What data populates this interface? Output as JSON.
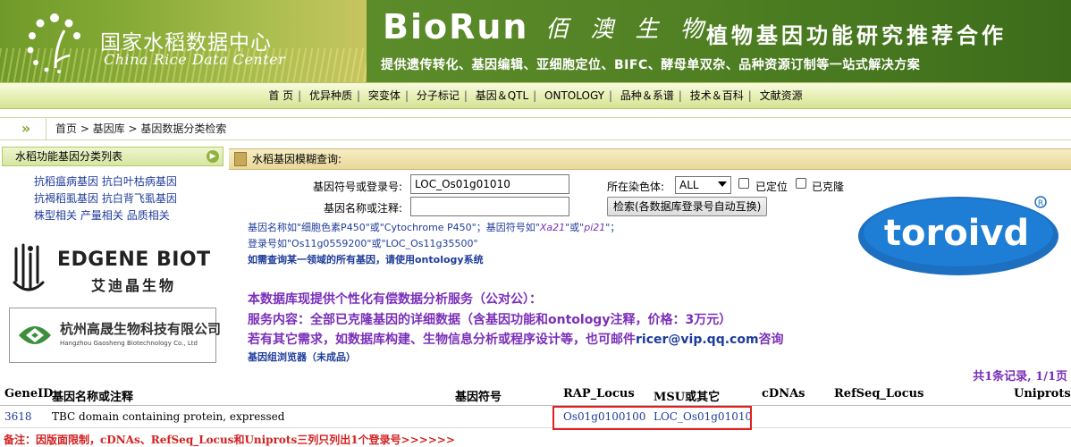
{
  "banner": {
    "cn_title": "国家水稻数据中心",
    "en_subtitle": "China Rice Data Center",
    "ad_brand": "BioRun",
    "ad_brand_cn": "佰 澳 生 物",
    "ad_slogan": "植物基因功能研究推荐合作",
    "ad_services": "提供遗传转化、基因编辑、亚细胞定位、BIFC、酵母单双杂、品种资源订制等一站式解决方案"
  },
  "nav": {
    "items": [
      "首 页",
      "优异种质",
      "突变体",
      "分子标记",
      "基因＆QTL",
      "ONTOLOGY",
      "品种＆系谱",
      "技术＆百科",
      "文献资源"
    ]
  },
  "breadcrumb": {
    "arrow": "»",
    "text": "首页 > 基因库 > 基因数据分类检索"
  },
  "sidebar": {
    "title": "水稻功能基因分类列表",
    "links": [
      [
        "抗稻瘟病基因",
        "抗白叶枯病基因"
      ],
      [
        "抗褐稻虱基因",
        "抗白背飞虱基因"
      ],
      [
        "株型相关",
        "产量相关",
        "品质相关"
      ]
    ],
    "ad1_name": "EDGENE BIOT",
    "ad1_cn": "艾迪晶生物",
    "ad2_cn": "杭州高晟生物科技有限公司",
    "ad2_en": "Hangzhou Gaosheng Biotechnology Co., Ltd"
  },
  "query": {
    "panel_title": "水稻基因模糊查询:",
    "symbol_label": "基因符号或登录号:",
    "symbol_value": "LOC_Os01g01010",
    "name_label": "基因名称或注释:",
    "name_value": "",
    "chrom_label": "所在染色体:",
    "chrom_value": "ALL",
    "located_label": "已定位",
    "cloned_label": "已克隆",
    "search_button": "检索(各数据库登录号自动互换)",
    "hint1_a": "基因名称如\"细胞色素P450\"或\"Cytochrome P450\"；基因符号如\"",
    "hint1_b": "Xa21",
    "hint1_c": "\"或\"",
    "hint1_d": "pi21",
    "hint1_e": "\"；",
    "hint2": "登录号如\"Os11g0559200\"或\"LOC_Os11g35500\"",
    "hint3": "如需查询某一领域的所有基因，请使用ontology系统",
    "service1": "本数据库现提供个性化有偿数据分析服务（公对公）：",
    "service2": "服务内容：全部已克隆基因的详细数据（含基因功能和ontology注释，价格：3万元）",
    "service3_a": "若有其它需求，如数据库构建、生物信息分析或程序设计等，也可邮件",
    "service3_mail": "ricer@vip.qq.com",
    "service3_b": "咨询",
    "browser_link": "基因组浏览器（未成品）",
    "ad_logo": "toroivd"
  },
  "results": {
    "count_text": "共1条记录, 1/1页",
    "headers": {
      "geneid": "GeneID",
      "name": "基因名称或注释",
      "symbol": "基因符号",
      "rap": "RAP_Locus",
      "msu": "MSU或其它",
      "cdnas": "cDNAs",
      "refseq": "RefSeq_Locus",
      "uniprots": "Uniprots"
    },
    "rows": [
      {
        "geneid": "3618",
        "name": "TBC domain containing protein, expressed",
        "symbol": "",
        "rap": "Os01g0100100",
        "msu": "LOC_Os01g01010",
        "cdnas": "",
        "refseq": "",
        "uniprots": ""
      }
    ],
    "footnote": "备注：因版面限制，cDNAs、RefSeq_Locus和Uniprots三列只列出1个登录号>>>>>>"
  },
  "colors": {
    "link_blue": "#1f3c9a",
    "purple": "#7a2fb8",
    "red_note": "#d32020",
    "nav_green": "#d5e293"
  }
}
